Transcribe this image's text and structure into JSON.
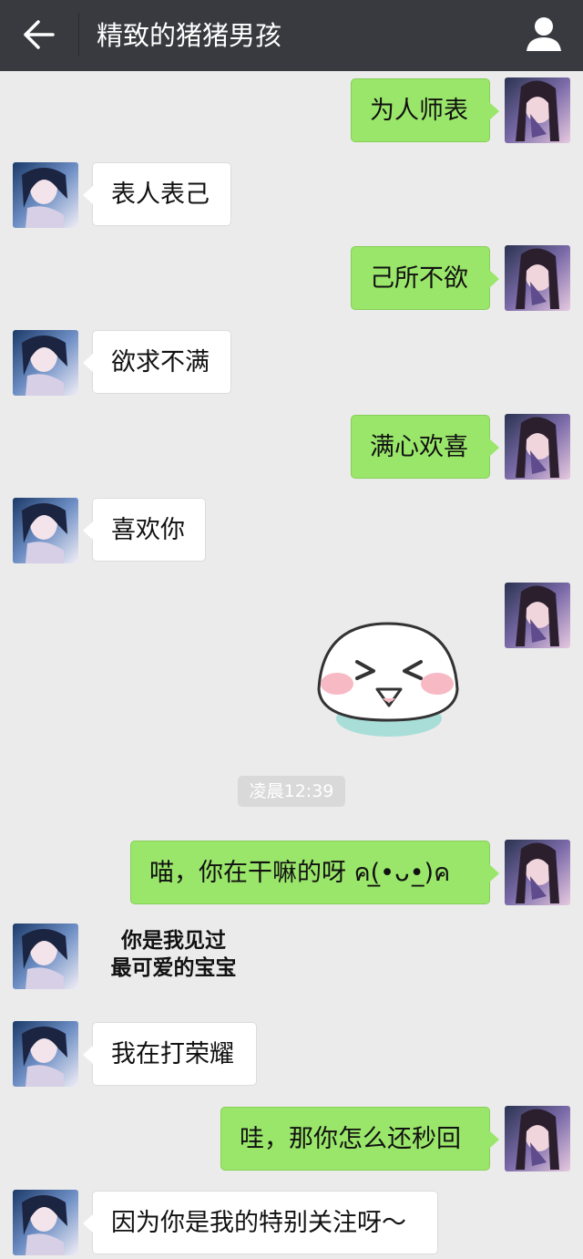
{
  "header": {
    "title": "精致的猪猪男孩",
    "back_icon": "arrow-left-icon",
    "profile_icon": "person-icon"
  },
  "timestamp": "凌晨12:39",
  "colors": {
    "header_bg": "#393a3f",
    "chat_bg": "#ebebeb",
    "outgoing_bubble": "#9ae66a",
    "incoming_bubble": "#ffffff"
  },
  "messages": [
    {
      "side": "out",
      "text": "为人师表"
    },
    {
      "side": "in",
      "text": "表人表己"
    },
    {
      "side": "out",
      "text": "己所不欲"
    },
    {
      "side": "in",
      "text": "欲求不满"
    },
    {
      "side": "out",
      "text": "满心欢喜"
    },
    {
      "side": "in",
      "text": "喜欢你"
    },
    {
      "side": "out",
      "sticker": "smiling-dumpling-sticker"
    },
    {
      "side": "out",
      "text": "喵，你在干嘛的呀 ค(̲•ᴗ•̲)ค"
    },
    {
      "side": "in",
      "sticker_text": [
        "你是我见过",
        "最可爱的宝宝"
      ]
    },
    {
      "side": "in",
      "text": "我在打荣耀"
    },
    {
      "side": "out",
      "text": "哇，那你怎么还秒回"
    },
    {
      "side": "in",
      "text": "因为你是我的特别关注呀～"
    }
  ]
}
